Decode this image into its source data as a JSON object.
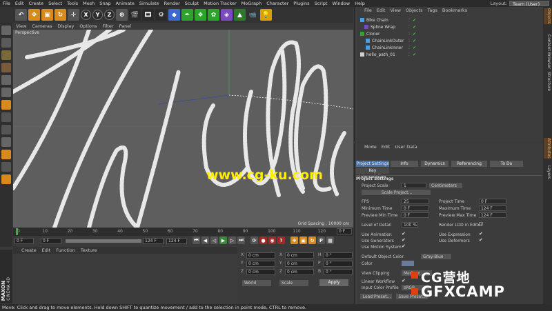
{
  "menubar": {
    "items": [
      "File",
      "Edit",
      "Create",
      "Select",
      "Tools",
      "Mesh",
      "Snap",
      "Animate",
      "Simulate",
      "Render",
      "Sculpt",
      "Motion Tracker",
      "MoGraph",
      "Character",
      "Plugins",
      "Script",
      "Window",
      "Help"
    ],
    "layout_label": "Layout:",
    "layout_value": "Team (User)"
  },
  "toolbar": {
    "axes": [
      "X",
      "Y",
      "Z"
    ]
  },
  "viewport": {
    "menu": [
      "View",
      "Cameras",
      "Display",
      "Options",
      "Filter",
      "Panel"
    ],
    "label": "Perspective",
    "grid_spacing": "Grid Spacing : 10000 cm"
  },
  "timeline": {
    "ticks": [
      "0",
      "10",
      "20",
      "30",
      "40",
      "50",
      "60",
      "70",
      "80",
      "90",
      "100",
      "110",
      "120"
    ],
    "end_frame": "0 F"
  },
  "transport": {
    "current": "0 F",
    "start": "0 F",
    "end": "124 F",
    "end2": "124 F"
  },
  "material": {
    "menu": [
      "Create",
      "Edit",
      "Function",
      "Texture"
    ]
  },
  "coords": {
    "rows": [
      [
        "X",
        "0 cm",
        "X",
        "0 cm",
        "H",
        "0 °"
      ],
      [
        "Y",
        "0 cm",
        "Y",
        "0 cm",
        "P",
        "0 °"
      ],
      [
        "Z",
        "0 cm",
        "Z",
        "0 cm",
        "B",
        "0 °"
      ]
    ],
    "mode1": "World",
    "mode2": "Scale",
    "apply": "Apply"
  },
  "logo": {
    "line1": "MAXON",
    "line2": "CINEMA 4D"
  },
  "status": {
    "text": "Move: Click and drag to move elements. Hold down SHIFT to quantize movement / add to the selection in point mode, CTRL to remove."
  },
  "objects": {
    "menu": [
      "File",
      "Edit",
      "View",
      "Objects",
      "Tags",
      "Bookmarks"
    ],
    "items": [
      {
        "name": "Bike Chain"
      },
      {
        "name": "Spline Wrap"
      },
      {
        "name": "Cloner"
      },
      {
        "name": "ChainLinkOuter"
      },
      {
        "name": "ChainLinkInner"
      },
      {
        "name": "hello_path_01"
      }
    ]
  },
  "attributes": {
    "menu": [
      "Mode",
      "Edit",
      "User Data"
    ],
    "tabs": [
      "Project Settings",
      "Info",
      "Dynamics",
      "Referencing",
      "To Do"
    ],
    "subtab": "Key Interpolation",
    "section": "Project Settings",
    "project_scale_label": "Project Scale",
    "project_scale_value": "1",
    "project_scale_unit": "Centimeters",
    "scale_project_btn": "Scale Project...",
    "fps_label": "FPS",
    "fps": "25",
    "project_time_label": "Project Time",
    "project_time": "0 F",
    "min_time_label": "Minimum Time",
    "min_time": "0 F",
    "max_time_label": "Maximum Time",
    "max_time": "124 F",
    "prev_min_label": "Preview Min Time",
    "prev_min": "0 F",
    "prev_max_label": "Preview Max Time",
    "prev_max": "124 F",
    "lod_label": "Level of Detail",
    "lod": "100 %",
    "render_lod_label": "Render LOD in Editor",
    "use_anim": "Use Animation",
    "use_expr": "Use Expression",
    "use_gen": "Use Generators",
    "use_deform": "Use Deformers",
    "use_motion": "Use Motion System",
    "def_obj_color_label": "Default Object Color",
    "def_obj_color": "Gray-Blue",
    "color_label": "Color",
    "view_clip_label": "View Clipping",
    "view_clip": "Medium",
    "linear_wf_label": "Linear Workflow",
    "input_cp_label": "Input Color Profile",
    "input_cp": "sRGB",
    "load_preset": "Load Preset...",
    "save_preset": "Save Preset..."
  },
  "right_tabs": [
    "Objects",
    "Content Browser",
    "Structure",
    "Attributes",
    "Layers"
  ],
  "watermark": {
    "cg": "CG营地",
    "gfx": "GFXCAMP",
    "url": "www.cg-ku.com"
  },
  "colors": {
    "accent_orange": "#e07a20",
    "viewport_bg": "#5e5e5e",
    "selected_tab": "#4a6fa5"
  }
}
